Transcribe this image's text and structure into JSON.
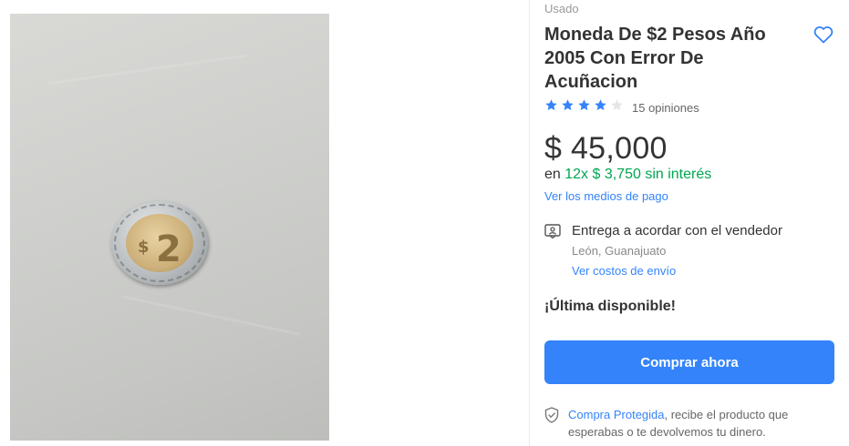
{
  "product": {
    "condition": "Usado",
    "title": "Moneda De $2 Pesos Año 2005 Con Error De Acuñacion",
    "rating_value": 4,
    "rating_max": 5,
    "reviews_label": "15 opiniones",
    "price": "$ 45,000",
    "installments_prefix": "en",
    "installments_text": "12x $ 3,750 sin interés",
    "payment_methods_link": "Ver los medios de pago"
  },
  "shipping": {
    "title": "Entrega a acordar con el vendedor",
    "location": "León, Guanajuato",
    "costs_link": "Ver costos de envío"
  },
  "stock": {
    "label": "¡Última disponible!"
  },
  "actions": {
    "buy_now_label": "Comprar ahora"
  },
  "protection": {
    "link_text": "Compra Protegida",
    "text": ", recibe el producto que esperabas o te devolvemos tu dinero."
  },
  "photo": {
    "coin_denomination": "2",
    "coin_sign": "$"
  },
  "colors": {
    "accent_blue": "#3483fa",
    "installments_green": "#00a650",
    "star_filled": "#3483fa",
    "star_empty": "#e6e6e6"
  },
  "icons": {
    "favorite": "heart-icon",
    "shipping": "handshake-card-icon",
    "protection": "shield-check-icon",
    "rating": "star-icon"
  }
}
